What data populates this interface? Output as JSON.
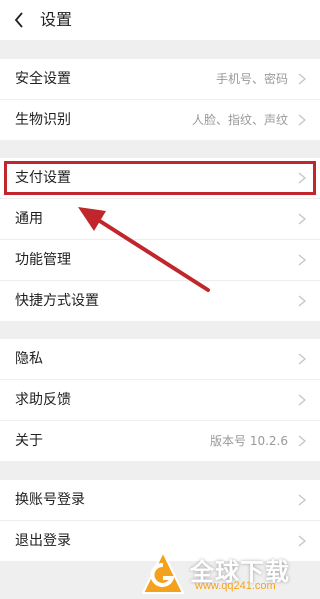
{
  "header": {
    "title": "设置"
  },
  "sections": [
    {
      "rows": [
        {
          "label": "安全设置",
          "value": "手机号、密码"
        },
        {
          "label": "生物识别",
          "value": "人脸、指纹、声纹"
        }
      ]
    },
    {
      "rows": [
        {
          "label": "支付设置",
          "value": ""
        },
        {
          "label": "通用",
          "value": ""
        },
        {
          "label": "功能管理",
          "value": ""
        },
        {
          "label": "快捷方式设置",
          "value": ""
        }
      ]
    },
    {
      "rows": [
        {
          "label": "隐私",
          "value": ""
        },
        {
          "label": "求助反馈",
          "value": ""
        },
        {
          "label": "关于",
          "value": "版本号 10.2.6"
        }
      ]
    },
    {
      "rows": [
        {
          "label": "换账号登录",
          "value": ""
        },
        {
          "label": "退出登录",
          "value": ""
        }
      ]
    }
  ],
  "watermark": {
    "text": "全球下载",
    "url": "www.qq241.com"
  },
  "colors": {
    "annotation": "#c0262b",
    "watermark_accent": "#f4a21d"
  }
}
